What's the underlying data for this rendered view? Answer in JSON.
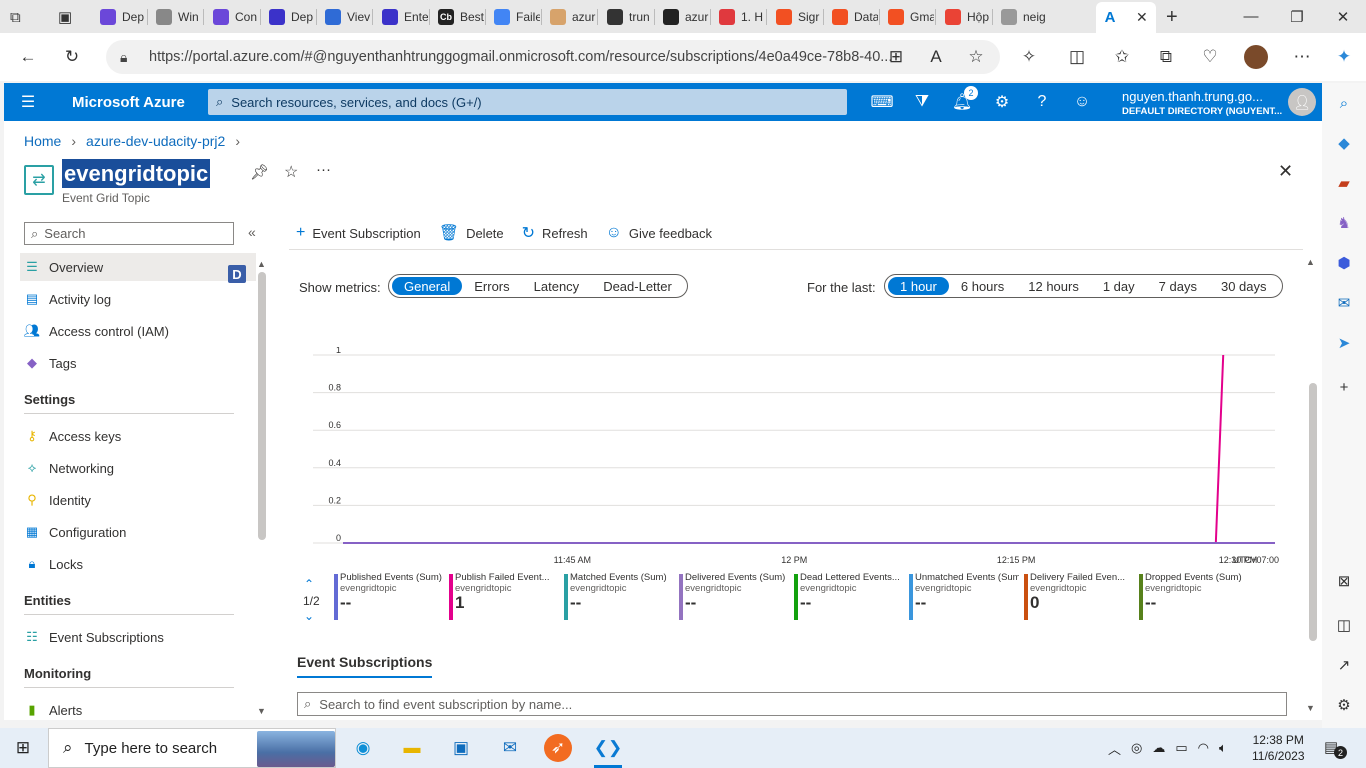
{
  "browser": {
    "tabs": [
      {
        "label": "Dep",
        "color": "#6b47d9"
      },
      {
        "label": "Win",
        "color": "#888888"
      },
      {
        "label": "Con",
        "color": "#6b47d9"
      },
      {
        "label": "Dep",
        "color": "#3b32c9"
      },
      {
        "label": "Viev",
        "color": "#2f6bd6"
      },
      {
        "label": "Ente",
        "color": "#3b32c9"
      },
      {
        "label": "Best",
        "color": "#222222"
      },
      {
        "label": "Faile",
        "color": "#4285f4"
      },
      {
        "label": "azur",
        "color": "#d7a36b"
      },
      {
        "label": "trun",
        "color": "#333333"
      },
      {
        "label": "azur",
        "color": "#222222"
      },
      {
        "label": "1. H",
        "color": "#e0393e"
      },
      {
        "label": "Sigr",
        "color": "#f25022"
      },
      {
        "label": "Data",
        "color": "#f25022"
      },
      {
        "label": "Gma",
        "color": "#f25022"
      },
      {
        "label": "Hộp",
        "color": "#ea4335"
      },
      {
        "label": "neig",
        "color": "#999999"
      }
    ],
    "fav_letters": {
      "best": "Cb"
    },
    "active_tab_label": "",
    "url": "https://portal.azure.com/#@nguyenthanhtrunggogmail.onmicrosoft.com/resource/subscriptions/4e0a49ce-78b8-40..."
  },
  "portal": {
    "brand": "Microsoft Azure",
    "search_placeholder": "Search resources, services, and docs (G+/)",
    "notification_count": "2",
    "user_name": "nguyen.thanh.trung.go...",
    "user_directory": "DEFAULT DIRECTORY (NGUYENT..."
  },
  "breadcrumb": [
    "Home",
    "azure-dev-udacity-prj2"
  ],
  "resource": {
    "title": "evengridtopic",
    "subtitle": "Event Grid Topic"
  },
  "sidebar": {
    "search_placeholder": "Search",
    "badge": "D",
    "items_top": [
      {
        "label": "Overview",
        "icon": "overview-icon"
      },
      {
        "label": "Activity log",
        "icon": "activity-log-icon"
      },
      {
        "label": "Access control (IAM)",
        "icon": "iam-icon"
      },
      {
        "label": "Tags",
        "icon": "tag-icon"
      }
    ],
    "settings_header": "Settings",
    "settings_items": [
      {
        "label": "Access keys",
        "icon": "key-icon"
      },
      {
        "label": "Networking",
        "icon": "network-icon"
      },
      {
        "label": "Identity",
        "icon": "identity-icon"
      },
      {
        "label": "Configuration",
        "icon": "configuration-icon"
      },
      {
        "label": "Locks",
        "icon": "lock-icon"
      }
    ],
    "entities_header": "Entities",
    "entities_items": [
      {
        "label": "Event Subscriptions",
        "icon": "event-subscriptions-icon"
      }
    ],
    "monitoring_header": "Monitoring",
    "monitoring_items": [
      {
        "label": "Alerts",
        "icon": "alert-icon"
      }
    ]
  },
  "commands": {
    "event_subscription": "Event Subscription",
    "delete": "Delete",
    "refresh": "Refresh",
    "feedback": "Give feedback"
  },
  "metrics": {
    "show_label": "Show metrics:",
    "options": [
      "General",
      "Errors",
      "Latency",
      "Dead-Letter"
    ],
    "selected": "General",
    "range_label": "For the last:",
    "ranges": [
      "1 hour",
      "6 hours",
      "12 hours",
      "1 day",
      "7 days",
      "30 days"
    ],
    "selected_range": "1 hour"
  },
  "chart_data": {
    "type": "line",
    "title": "",
    "xlabel": "",
    "ylabel": "",
    "x_ticks": [
      "11:45 AM",
      "12 PM",
      "12:15 PM",
      "12:30 PM"
    ],
    "timezone": "UTC+07:00",
    "y_ticks": [
      "0",
      "0.2",
      "0.4",
      "0.6",
      "0.8",
      "1"
    ],
    "ylim": [
      0,
      1
    ],
    "x_minutes_range": [
      -10.5,
      52.5
    ],
    "series": [
      {
        "name": "Publish Failed Events (Sum)",
        "color": "#e3008c",
        "x_minutes_after_1140": [
          -10.5,
          47.5,
          48.5,
          49.0
        ],
        "values": [
          0,
          0,
          0,
          1
        ]
      },
      {
        "name": "Published Events (Sum)",
        "color": "#8661c5",
        "x_minutes_after_1140": [
          -10.5,
          52.5
        ],
        "values": [
          0,
          0
        ]
      }
    ]
  },
  "legend": {
    "page": "1/2",
    "items": [
      {
        "name": "Published Events (Sum)",
        "resource": "evengridtopic",
        "value": "--",
        "color": "#636bd5"
      },
      {
        "name": "Publish Failed Event...",
        "resource": "evengridtopic",
        "value": "1",
        "color": "#e3008c"
      },
      {
        "name": "Matched Events (Sum)",
        "resource": "evengridtopic",
        "value": "--",
        "color": "#2aa0a4"
      },
      {
        "name": "Delivered Events (Sum)",
        "resource": "evengridtopic",
        "value": "--",
        "color": "#9373c0"
      },
      {
        "name": "Dead Lettered Events...",
        "resource": "evengridtopic",
        "value": "--",
        "color": "#13a10e"
      },
      {
        "name": "Unmatched Events (Sum)",
        "resource": "evengridtopic",
        "value": "--",
        "color": "#3a96dd"
      },
      {
        "name": "Delivery Failed Even...",
        "resource": "evengridtopic",
        "value": "0",
        "color": "#ca5010"
      },
      {
        "name": "Dropped Events (Sum)",
        "resource": "evengridtopic",
        "value": "--",
        "color": "#57811b"
      }
    ]
  },
  "event_subscriptions": {
    "title": "Event Subscriptions",
    "search_placeholder": "Search to find event subscription by name..."
  },
  "taskbar": {
    "search_placeholder": "Type here to search",
    "time": "12:38 PM",
    "date": "11/6/2023",
    "notification_count": "2"
  }
}
